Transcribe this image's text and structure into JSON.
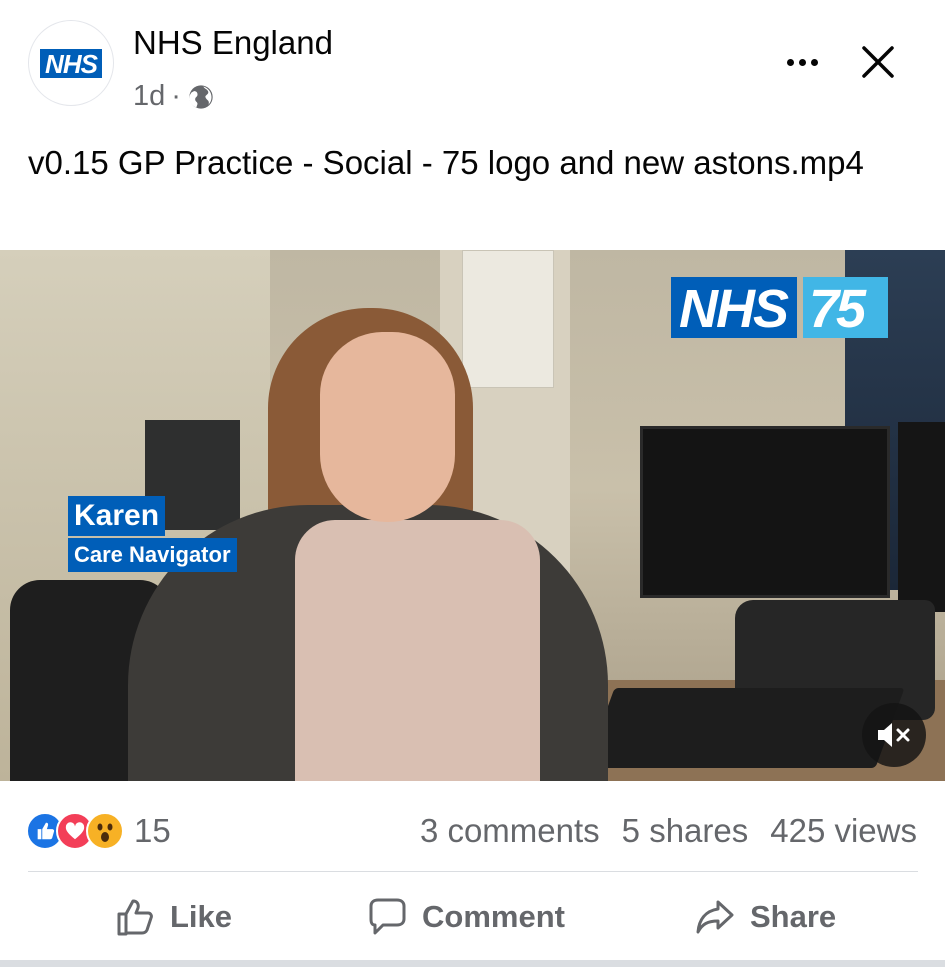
{
  "header": {
    "avatar_logo": "NHS",
    "page_name": "NHS England",
    "time_ago": "1d",
    "separator": "·",
    "privacy_icon": "globe-icon"
  },
  "post": {
    "text": "v0.15 GP Practice - Social - 75 logo and new astons.mp4"
  },
  "video": {
    "logo_nhs": "NHS",
    "logo_75": "75",
    "lower_third_name": "Karen",
    "lower_third_role": "Care Navigator",
    "mute_icon": "speaker-muted-icon"
  },
  "engagement": {
    "reaction_icons": [
      "like-icon",
      "love-icon",
      "wow-icon"
    ],
    "reaction_count": "15",
    "comments": "3 comments",
    "shares": "5 shares",
    "views": "425 views"
  },
  "actions": {
    "like": "Like",
    "comment": "Comment",
    "share": "Share"
  },
  "colors": {
    "nhs_blue": "#005eb8",
    "nhs_light_blue": "#41b6e6",
    "like_blue": "#1b74e4",
    "love_red": "#f33e58",
    "wow_yellow": "#f7b125",
    "secondary_text": "#65676b"
  }
}
